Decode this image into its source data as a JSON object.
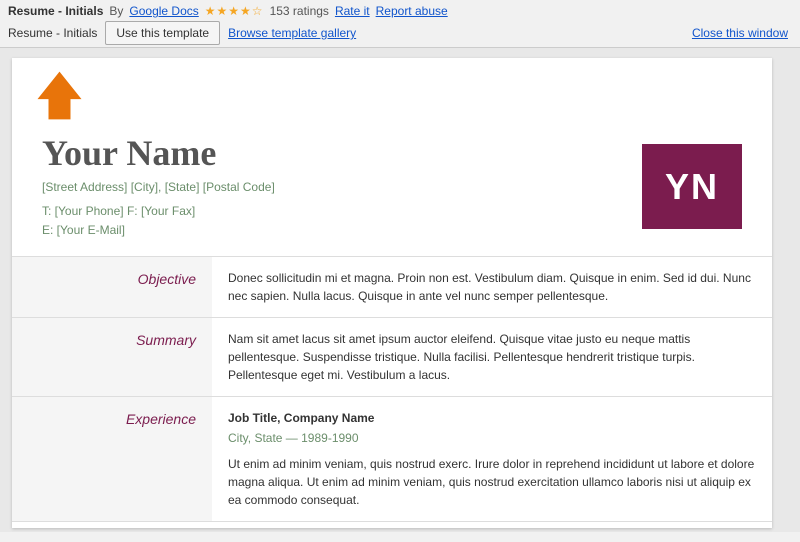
{
  "topbar": {
    "title": "Resume - Initials",
    "by_text": "By",
    "by_link": "Google Docs",
    "stars": "★★★★☆",
    "ratings": "153 ratings",
    "rate_label": "Rate it",
    "abuse_label": "Report abuse",
    "breadcrumb": "Resume - Initials",
    "use_template_label": "Use this template",
    "browse_label": "Browse template gallery",
    "close_label": "Close this window"
  },
  "resume": {
    "name": "Your Name",
    "address": "[Street Address] [City], [State] [Postal Code]",
    "phone": "T: [Your Phone]  F: [Your Fax]",
    "email": "E: [Your E-Mail]",
    "initials": "YN",
    "sections": [
      {
        "label": "Objective",
        "content": "Donec sollicitudin mi et magna. Proin non est. Vestibulum diam. Quisque in enim. Sed id dui. Nunc nec sapien. Nulla lacus. Quisque in ante vel nunc semper pellentesque."
      },
      {
        "label": "Summary",
        "content": "Nam sit amet lacus sit amet ipsum auctor eleifend. Quisque vitae justo eu neque mattis pellentesque. Suspendisse tristique. Nulla facilisi. Pellentesque hendrerit tristique turpis. Pellentesque eget mi. Vestibulum a lacus."
      },
      {
        "label": "Experience",
        "job_title": "Job Title, Company Name",
        "job_sub": "City, State — 1989-1990",
        "content": "Ut enim ad minim veniam, quis nostrud exerc. Irure dolor in reprehend incididunt ut labore et dolore magna aliqua. Ut enim ad minim veniam, quis nostrud exercitation ullamco laboris nisi ut aliquip ex ea commodo consequat."
      }
    ]
  },
  "arrow": {
    "color": "#e8740a"
  }
}
